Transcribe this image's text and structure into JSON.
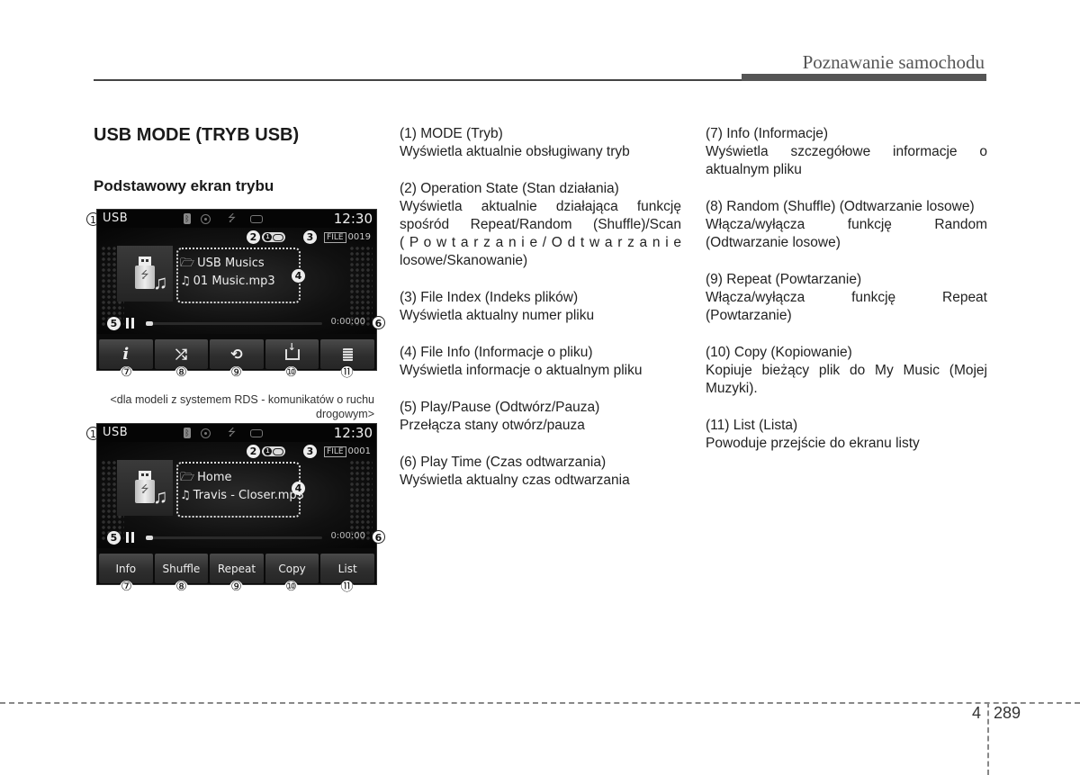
{
  "header": {
    "section_title": "Poznawanie samochodu"
  },
  "headings": {
    "main": "USB MODE (TRYB USB)",
    "sub": "Podstawowy ekran trybu"
  },
  "screens": [
    {
      "mode_label": "USB",
      "clock": "12:30",
      "status_icons": [
        "bluetooth-icon",
        "disc-icon",
        "usb-icon",
        "aux-icon"
      ],
      "file_tag": "FILE",
      "file_index": "0019",
      "folder": "USB Musics",
      "track": "01 Music.mp3",
      "play_time": "0:00:00",
      "progress_fraction": 0.0,
      "buttons": [
        {
          "id": "info",
          "icon": "info-icon",
          "glyph": "i",
          "label": ""
        },
        {
          "id": "shuffle",
          "icon": "shuffle-icon",
          "glyph": "⤮",
          "label": ""
        },
        {
          "id": "repeat",
          "icon": "repeat-icon",
          "glyph": "⟲",
          "label": ""
        },
        {
          "id": "copy",
          "icon": "copy-icon",
          "glyph": "",
          "label": ""
        },
        {
          "id": "list",
          "icon": "list-icon",
          "glyph": "",
          "label": ""
        }
      ]
    },
    {
      "mode_label": "USB",
      "clock": "12:30",
      "status_icons": [
        "bluetooth-icon",
        "disc-icon",
        "usb-icon",
        "aux-icon"
      ],
      "file_tag": "FILE",
      "file_index": "0001",
      "folder": "Home",
      "track": "Travis - Closer.mp3",
      "play_time": "0:00:00",
      "progress_fraction": 0.0,
      "buttons": [
        {
          "id": "info",
          "label": "Info"
        },
        {
          "id": "shuffle",
          "label": "Shuffle"
        },
        {
          "id": "repeat",
          "label": "Repeat"
        },
        {
          "id": "copy",
          "label": "Copy"
        },
        {
          "id": "list",
          "label": "List"
        }
      ]
    }
  ],
  "callouts": [
    "①",
    "②",
    "③",
    "④",
    "⑤",
    "⑥",
    "⑦",
    "⑧",
    "⑨",
    "⑩",
    "⑪"
  ],
  "callout_digits": [
    "1",
    "2",
    "3",
    "4",
    "5",
    "6"
  ],
  "caption": "<dla modeli z systemem RDS - komunikatów o ruchu drogowym>",
  "descriptions_col1": [
    {
      "title": "(1) MODE (Tryb)",
      "desc": "Wyświetla aktualnie obsługiwany tryb"
    },
    {
      "title": "(2) Operation State (Stan działania)",
      "desc": "Wyświetla aktualnie działająca funkcję spośród Repeat/Random (Shuffle)/Scan",
      "desc_spread": "( P o w t a r z a n i e / O d t w a r z a n i e",
      "desc_end": "losowe/Skanowanie)"
    },
    {
      "title": "(3) File Index (Indeks plików)",
      "desc": "Wyświetla aktualny numer pliku"
    },
    {
      "title": "(4) File Info (Informacje o pliku)",
      "desc": "Wyświetla informacje o aktualnym pliku"
    },
    {
      "title": "(5) Play/Pause (Odtwórz/Pauza)",
      "desc": "Przełącza stany otwórz/pauza"
    },
    {
      "title": "(6) Play Time (Czas odtwarzania)",
      "desc": "Wyświetla aktualny czas odtwarzania"
    }
  ],
  "descriptions_col2": [
    {
      "title": "(7) Info (Informacje)",
      "desc": "Wyświetla szczegółowe informacje o aktualnym pliku"
    },
    {
      "title": "(8) Random (Shuffle) (Odtwarzanie losowe)",
      "desc": "Włącza/wyłącza funkcję Random (Odtwarzanie losowe)"
    },
    {
      "title": "(9) Repeat (Powtarzanie)",
      "desc": "Włącza/wyłącza funkcję Repeat (Powtarzanie)"
    },
    {
      "title": "(10) Copy (Kopiowanie)",
      "desc": "Kopiuje bieżący plik do My Music (Mojej Muzyki)."
    },
    {
      "title": "(11) List (Lista)",
      "desc": "Powoduje przejście do ekranu listy"
    }
  ],
  "footer": {
    "chapter": "4",
    "page": "289"
  }
}
